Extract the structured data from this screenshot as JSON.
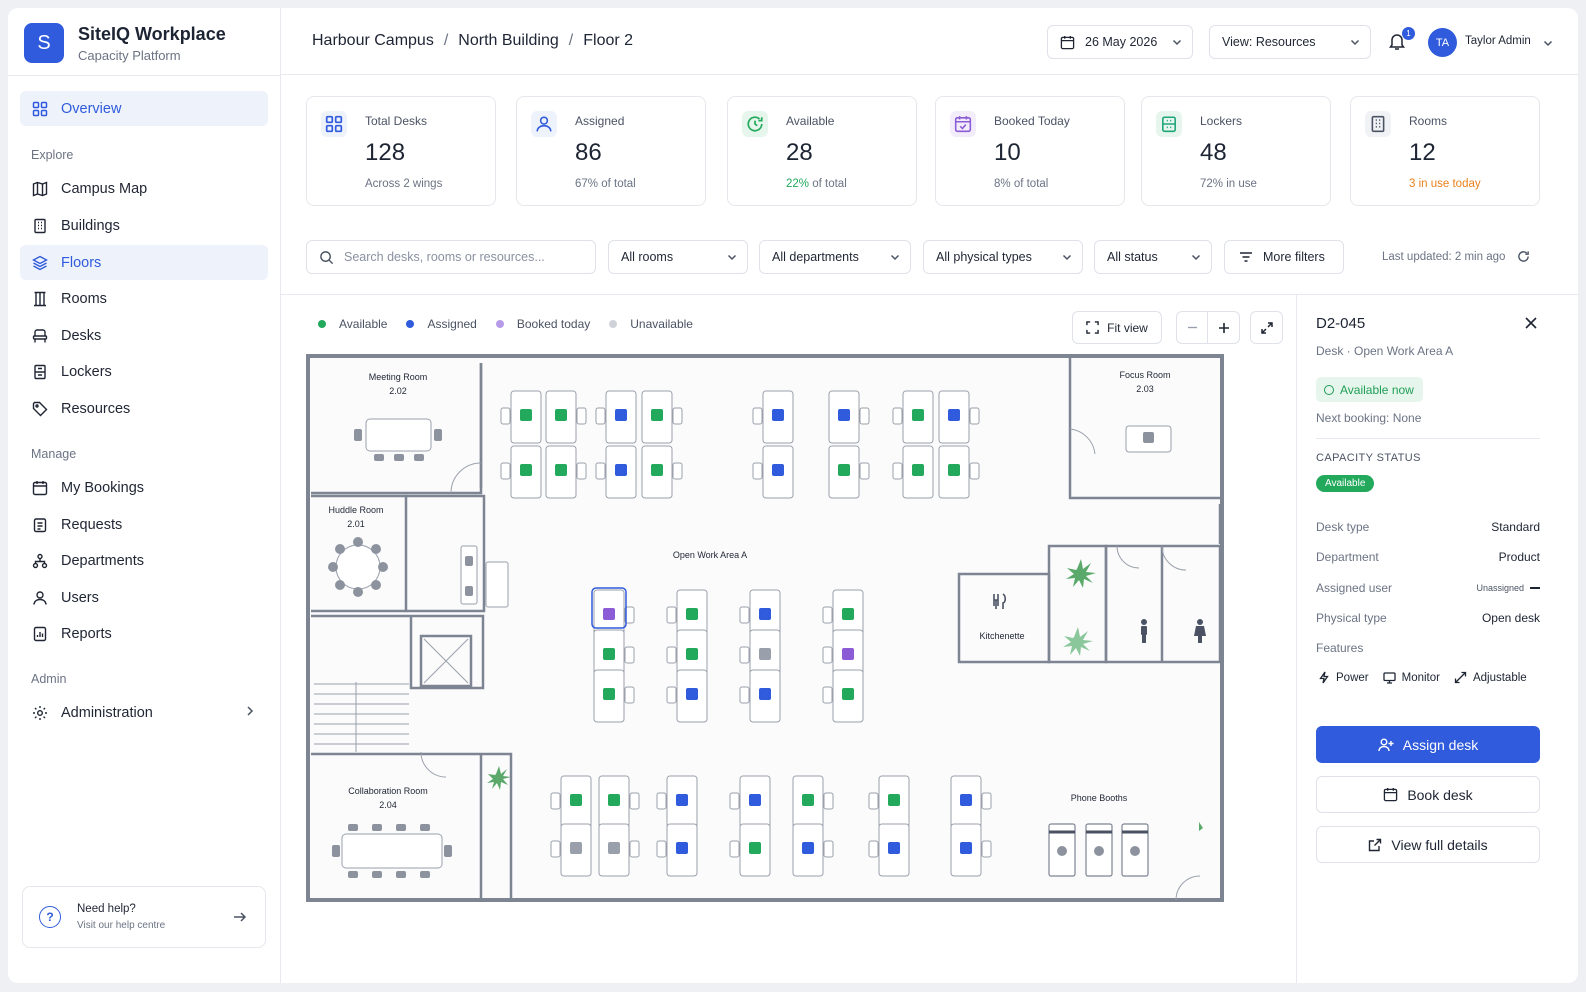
{
  "brand": {
    "logo_letter": "S",
    "title": "SiteIQ Workplace",
    "subtitle": "Capacity Platform"
  },
  "sidebar": {
    "overview": "Overview",
    "sections": {
      "explore": "Explore",
      "manage": "Manage",
      "admin": "Admin"
    },
    "explore_items": [
      "Campus Map",
      "Buildings",
      "Floors",
      "Rooms",
      "Desks",
      "Lockers",
      "Resources"
    ],
    "manage_items": [
      "My Bookings",
      "Requests",
      "Departments",
      "Users",
      "Reports"
    ],
    "admin_items": [
      "Administration"
    ],
    "help": {
      "title": "Need help?",
      "subtitle": "Visit our help centre"
    }
  },
  "header": {
    "breadcrumb": [
      "Harbour Campus",
      "North Building",
      "Floor 2"
    ],
    "date": "26 May 2026",
    "view": "View: Resources",
    "notifications": "1",
    "user_initials": "TA",
    "user_name": "Taylor Admin"
  },
  "stats": [
    {
      "label": "Total Desks",
      "value": "128",
      "sub": "Across 2 wings"
    },
    {
      "label": "Assigned",
      "value": "86",
      "sub": "67% of total"
    },
    {
      "label": "Available",
      "value": "28",
      "sub_highlight": "22%",
      "sub": " of total"
    },
    {
      "label": "Booked Today",
      "value": "10",
      "sub": "8% of total"
    },
    {
      "label": "Lockers",
      "value": "48",
      "sub": "72% in use"
    },
    {
      "label": "Rooms",
      "value": "12",
      "sub": "3 in use today"
    }
  ],
  "filters": {
    "search_placeholder": "Search desks, rooms or resources...",
    "rooms": "All rooms",
    "departments": "All departments",
    "physical_types": "All physical types",
    "status": "All status",
    "more": "More filters",
    "last_updated": "Last updated: 2 min ago"
  },
  "legend": [
    "Available",
    "Assigned",
    "Booked today",
    "Unavailable"
  ],
  "map_controls": {
    "fit_view": "Fit view"
  },
  "floorplan": {
    "rooms": {
      "meeting": [
        "Meeting Room",
        "2.02"
      ],
      "focus": [
        "Focus Room",
        "2.03"
      ],
      "huddle": [
        "Huddle Room",
        "2.01"
      ],
      "collab": [
        "Collaboration Room",
        "2.04"
      ],
      "open_area": "Open Work Area A",
      "kitchenette": "Kitchenette",
      "phone_booths": "Phone Booths"
    }
  },
  "colors": {
    "available": "#22a95c",
    "assigned": "#2f5bdc",
    "booked": "#8b5cd6",
    "unavailable": "#9aa0ab",
    "accent": "#2f5bdc"
  },
  "detail": {
    "title": "D2-045",
    "subtitle": "Desk · Open Work Area A",
    "status": "Available now",
    "next_booking": "Next booking: None",
    "capacity_label": "CAPACITY STATUS",
    "capacity_value": "Available",
    "rows": [
      {
        "key": "Desk type",
        "value": "Standard"
      },
      {
        "key": "Department",
        "value": "Product"
      },
      {
        "key": "Assigned user",
        "value": "Unassigned"
      },
      {
        "key": "Physical type",
        "value": "Open desk"
      },
      {
        "key": "Features",
        "value": ""
      }
    ],
    "features": [
      "Power",
      "Monitor",
      "Adjustable"
    ],
    "assign": "Assign desk",
    "book": "Book desk",
    "view_details": "View full details"
  }
}
